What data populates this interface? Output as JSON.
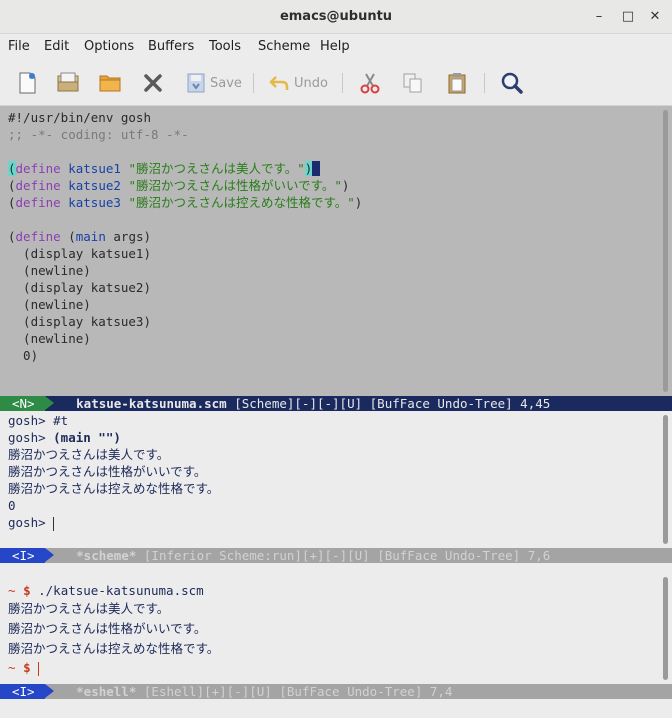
{
  "window": {
    "title": "emacs@ubuntu",
    "minimize_glyph": "–",
    "maximize_glyph": "□",
    "close_glyph": "✕"
  },
  "menu": [
    "File",
    "Edit",
    "Options",
    "Buffers",
    "Tools",
    "Scheme",
    "Help"
  ],
  "toolbar": {
    "save_label": "Save",
    "undo_label": "Undo",
    "icons": [
      "new-file-icon",
      "open-directory-icon",
      "open-folder-icon",
      "close-buffer-icon",
      "save-icon",
      "undo-icon",
      "cut-icon",
      "copy-icon",
      "paste-icon",
      "search-icon"
    ]
  },
  "editor": {
    "lines": [
      "#!/usr/bin/env gosh",
      ";; -*- coding: utf-8 -*-",
      "",
      "(define katsue1 \"勝沼かつえさんは美人です。\")",
      "(define katsue2 \"勝沼かつえさんは性格がいいです。\")",
      "(define katsue3 \"勝沼かつえさんは控えめな性格です。\")",
      "",
      "(define (main args)",
      "  (display katsue1)",
      "  (newline)",
      "  (display katsue2)",
      "  (newline)",
      "  (display katsue3)",
      "  (newline)",
      "  0)"
    ],
    "define_kw": "define",
    "var1": "katsue1",
    "var2": "katsue2",
    "var3": "katsue3",
    "str1": "\"勝沼かつえさんは美人です。\"",
    "str2": "\"勝沼かつえさんは性格がいいです。\"",
    "str3": "\"勝沼かつえさんは控えめな性格です。\"",
    "main_fn": "main",
    "args": "args"
  },
  "modeline_editor": {
    "state": "<N>",
    "buffer": "katsue-katsunuma.scm",
    "rest": " [Scheme][-][-][U] [BufFace Undo-Tree] 4,45"
  },
  "repl": {
    "lines": [
      {
        "prompt": "gosh> ",
        "text": "#t"
      },
      {
        "prompt": "gosh> ",
        "text": "(main \"\")",
        "bold": true
      },
      {
        "prompt": "",
        "text": "勝沼かつえさんは美人です。"
      },
      {
        "prompt": "",
        "text": "勝沼かつえさんは性格がいいです。"
      },
      {
        "prompt": "",
        "text": "勝沼かつえさんは控えめな性格です。"
      },
      {
        "prompt": "",
        "text": "0"
      },
      {
        "prompt": "gosh> ",
        "text": ""
      }
    ]
  },
  "modeline_repl": {
    "state": "<I>",
    "buffer": "*scheme*",
    "rest": " [Inferior Scheme:run][+][-][U] [BufFace Undo-Tree] 7,6"
  },
  "eshell": {
    "tilde": "~",
    "dollar": "$",
    "command": "./katsue-katsunuma.scm",
    "output": [
      "勝沼かつえさんは美人です。",
      "勝沼かつえさんは性格がいいです。",
      "勝沼かつえさんは控えめな性格です。"
    ]
  },
  "modeline_eshell": {
    "state": "<I>",
    "buffer": "*eshell*",
    "rest": " [Eshell][+][-][U] [BufFace Undo-Tree] 7,4"
  },
  "colors": {
    "editor_bg": "#b8b8b8",
    "modeline_active": "#1b2a5e",
    "modeline_inactive": "#a4a4a4",
    "state_normal": "#2e8b46",
    "state_insert": "#2546c6",
    "keyword": "#8a3fb3",
    "function": "#1a3fa8",
    "string": "#2a7d1a",
    "comment": "#7a7a7a",
    "prompt": "#c93a1a"
  }
}
